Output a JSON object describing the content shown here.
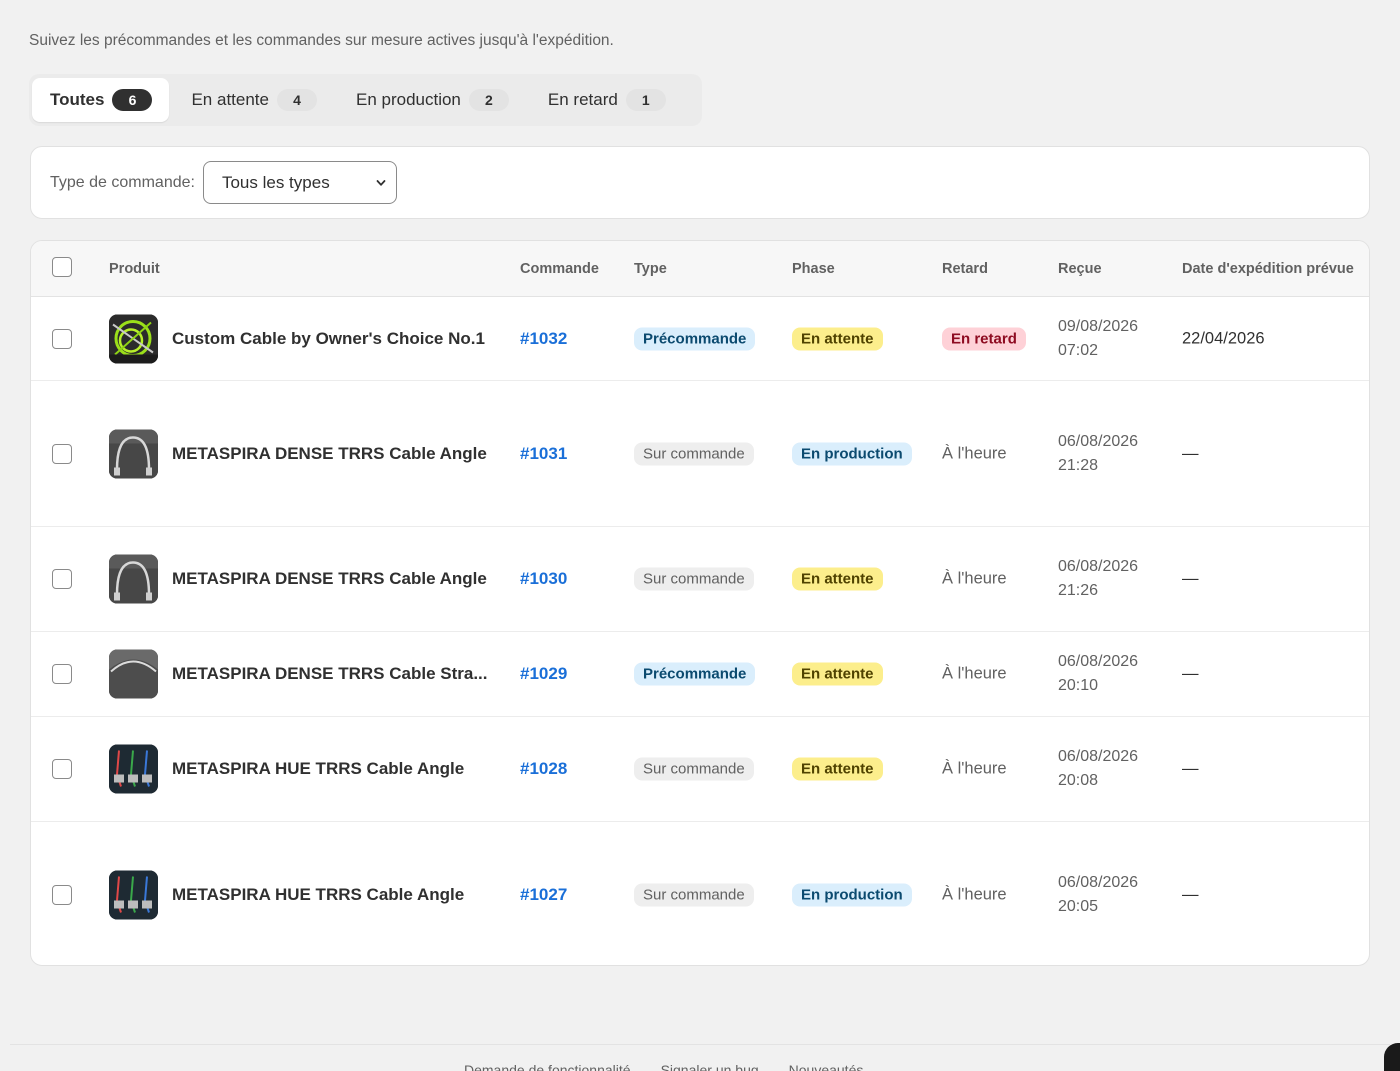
{
  "subtitle": "Suivez les précommandes et les commandes sur mesure actives jusqu'à l'expédition.",
  "tabs": [
    {
      "label": "Toutes",
      "count": "6",
      "active": true
    },
    {
      "label": "En attente",
      "count": "4",
      "active": false
    },
    {
      "label": "En production",
      "count": "2",
      "active": false
    },
    {
      "label": "En retard",
      "count": "1",
      "active": false
    }
  ],
  "filter": {
    "label": "Type de commande:",
    "value": "Tous les types"
  },
  "table": {
    "headers": {
      "product": "Produit",
      "order": "Commande",
      "type": "Type",
      "phase": "Phase",
      "delay": "Retard",
      "received": "Reçue",
      "ship_date": "Date d'expédition prévue"
    },
    "rows": [
      {
        "product": "Custom Cable by Owner's Choice No.1",
        "order": "#1032",
        "type": "Précommande",
        "phase": "En attente",
        "delay": "En retard",
        "received_date": "09/08/2026",
        "received_time": "07:02",
        "ship": "22/04/2026"
      },
      {
        "product": "METASPIRA DENSE TRRS Cable Angle",
        "order": "#1031",
        "type": "Sur commande",
        "phase": "En production",
        "delay": "À l'heure",
        "received_date": "06/08/2026",
        "received_time": "21:28",
        "ship": "—"
      },
      {
        "product": "METASPIRA DENSE TRRS Cable Angle",
        "order": "#1030",
        "type": "Sur commande",
        "phase": "En attente",
        "delay": "À l'heure",
        "received_date": "06/08/2026",
        "received_time": "21:26",
        "ship": "—"
      },
      {
        "product": "METASPIRA DENSE TRRS Cable Stra...",
        "order": "#1029",
        "type": "Précommande",
        "phase": "En attente",
        "delay": "À l'heure",
        "received_date": "06/08/2026",
        "received_time": "20:10",
        "ship": "—"
      },
      {
        "product": "METASPIRA HUE TRRS Cable Angle",
        "order": "#1028",
        "type": "Sur commande",
        "phase": "En attente",
        "delay": "À l'heure",
        "received_date": "06/08/2026",
        "received_time": "20:08",
        "ship": "—"
      },
      {
        "product": "METASPIRA HUE TRRS Cable Angle",
        "order": "#1027",
        "type": "Sur commande",
        "phase": "En production",
        "delay": "À l'heure",
        "received_date": "06/08/2026",
        "received_time": "20:05",
        "ship": "—"
      }
    ]
  },
  "footer": {
    "links": [
      "Demande de fonctionnalité",
      "Signaler un bug",
      "Nouveautés"
    ]
  },
  "colors": {
    "link": "#1a6fd8",
    "info_badge": "#daeefc",
    "warning_badge": "#fcee8c",
    "critical_badge": "#fed1d7"
  }
}
